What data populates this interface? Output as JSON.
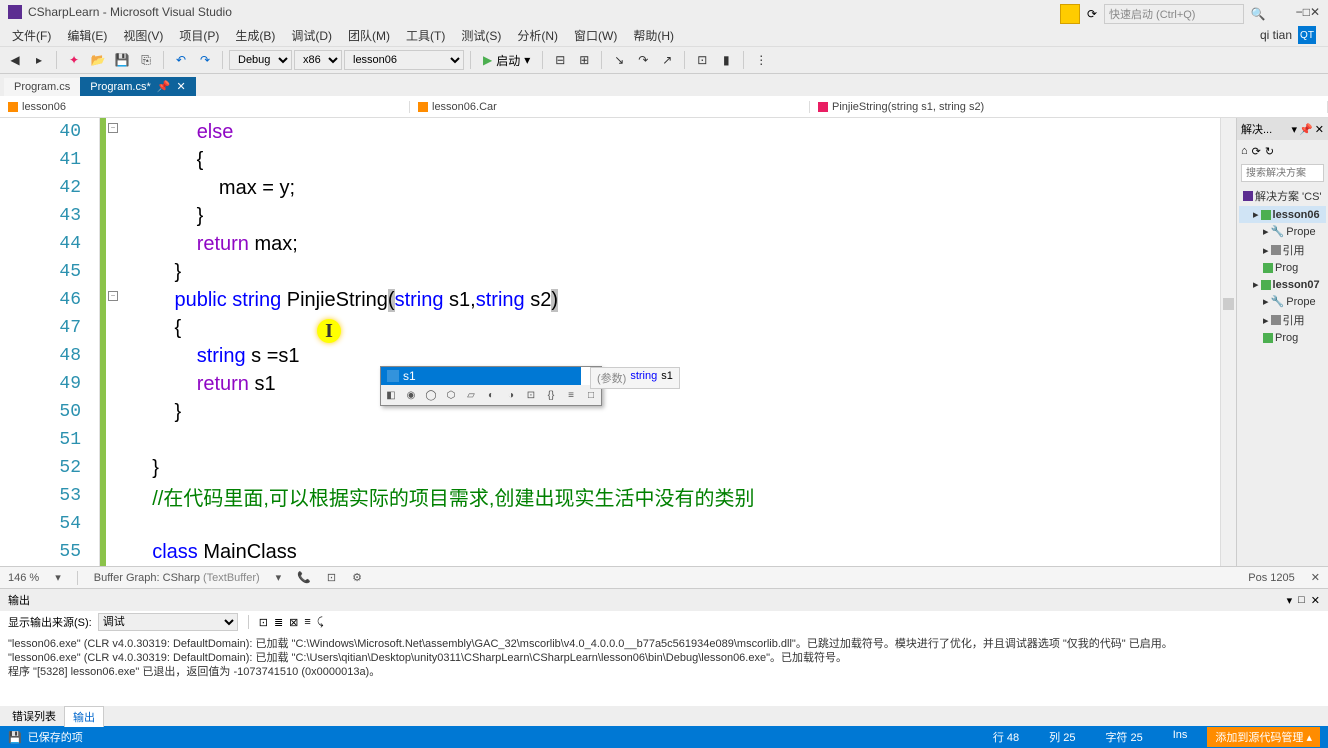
{
  "window": {
    "title": "CSharpLearn - Microsoft Visual Studio"
  },
  "quicklaunch": {
    "placeholder": "快速启动 (Ctrl+Q)"
  },
  "menu": {
    "items": [
      "文件(F)",
      "编辑(E)",
      "视图(V)",
      "项目(P)",
      "生成(B)",
      "调试(D)",
      "团队(M)",
      "工具(T)",
      "测试(S)",
      "分析(N)",
      "窗口(W)",
      "帮助(H)"
    ],
    "user": "qi tian",
    "user_badge": "QT"
  },
  "toolbar": {
    "config": "Debug",
    "platform": "x86",
    "project": "lesson06",
    "start": "启动"
  },
  "tabs": {
    "inactive": "Program.cs",
    "active": "Program.cs*"
  },
  "breadcrumb": {
    "project": "lesson06",
    "class": "lesson06.Car",
    "method": "PinjieString(string s1, string s2)"
  },
  "code": {
    "lines": [
      {
        "num": "40",
        "tokens": [
          {
            "t": "            ",
            "c": ""
          },
          {
            "t": "else",
            "c": "kw-purple"
          }
        ]
      },
      {
        "num": "41",
        "tokens": [
          {
            "t": "            {",
            "c": "punct"
          }
        ]
      },
      {
        "num": "42",
        "tokens": [
          {
            "t": "                max = y;",
            "c": "ident"
          }
        ]
      },
      {
        "num": "43",
        "tokens": [
          {
            "t": "            }",
            "c": "punct"
          }
        ]
      },
      {
        "num": "44",
        "tokens": [
          {
            "t": "            ",
            "c": ""
          },
          {
            "t": "return",
            "c": "kw-purple"
          },
          {
            "t": " max;",
            "c": "ident"
          }
        ]
      },
      {
        "num": "45",
        "tokens": [
          {
            "t": "        }",
            "c": "punct"
          }
        ]
      },
      {
        "num": "46",
        "tokens": [
          {
            "t": "        ",
            "c": ""
          },
          {
            "t": "public",
            "c": "kw-blue"
          },
          {
            "t": " ",
            "c": ""
          },
          {
            "t": "string",
            "c": "kw-blue"
          },
          {
            "t": " PinjieString",
            "c": "ident"
          },
          {
            "t": "(",
            "c": "paren-highlight"
          },
          {
            "t": "string",
            "c": "kw-blue"
          },
          {
            "t": " s1,",
            "c": "ident"
          },
          {
            "t": "string",
            "c": "kw-blue"
          },
          {
            "t": " s2",
            "c": "ident"
          },
          {
            "t": ")",
            "c": "paren-highlight"
          }
        ]
      },
      {
        "num": "47",
        "tokens": [
          {
            "t": "        {",
            "c": "punct"
          }
        ]
      },
      {
        "num": "48",
        "tokens": [
          {
            "t": "            ",
            "c": ""
          },
          {
            "t": "string",
            "c": "kw-blue"
          },
          {
            "t": " s =s1",
            "c": "ident"
          }
        ]
      },
      {
        "num": "49",
        "tokens": [
          {
            "t": "            ",
            "c": ""
          },
          {
            "t": "return",
            "c": "kw-purple"
          },
          {
            "t": " s1",
            "c": "ident"
          }
        ]
      },
      {
        "num": "50",
        "tokens": [
          {
            "t": "        }",
            "c": "punct"
          }
        ]
      },
      {
        "num": "51",
        "tokens": [
          {
            "t": "",
            "c": ""
          }
        ]
      },
      {
        "num": "52",
        "tokens": [
          {
            "t": "    }",
            "c": "punct"
          }
        ]
      },
      {
        "num": "53",
        "tokens": [
          {
            "t": "    ",
            "c": ""
          },
          {
            "t": "//在代码里面,可以根据实际的项目需求,创建出现实生活中没有的类别",
            "c": "comment"
          }
        ]
      },
      {
        "num": "54",
        "tokens": [
          {
            "t": "",
            "c": ""
          }
        ]
      },
      {
        "num": "55",
        "tokens": [
          {
            "t": "    ",
            "c": ""
          },
          {
            "t": "class",
            "c": "kw-blue"
          },
          {
            "t": " MainClass",
            "c": "ident"
          }
        ]
      }
    ]
  },
  "intellisense": {
    "selected": "s1",
    "tooltip_label": "(参数)",
    "tooltip_type": "string",
    "tooltip_name": "s1"
  },
  "info_bar": {
    "zoom": "146 %",
    "buffer": "Buffer Graph:",
    "lang": "CSharp",
    "textbuf": "(TextBuffer)",
    "pos": "Pos 1205"
  },
  "output": {
    "title": "输出",
    "source_label": "显示输出来源(S):",
    "source": "调试",
    "lines": [
      "\"lesson06.exe\" (CLR v4.0.30319: DefaultDomain): 已加载 \"C:\\Windows\\Microsoft.Net\\assembly\\GAC_32\\mscorlib\\v4.0_4.0.0.0__b77a5c561934e089\\mscorlib.dll\"。已跳过加载符号。模块进行了优化，并且调试器选项 \"仅我的代码\" 已启用。",
      "\"lesson06.exe\" (CLR v4.0.30319: DefaultDomain): 已加载 \"C:\\Users\\qitian\\Desktop\\unity0311\\CSharpLearn\\CSharpLearn\\lesson06\\bin\\Debug\\lesson06.exe\"。已加载符号。",
      "程序 \"[5328] lesson06.exe\" 已退出，返回值为 -1073741510 (0x0000013a)。"
    ]
  },
  "error_tabs": {
    "list": "错误列表",
    "output": "输出"
  },
  "status": {
    "msg": "已保存的项",
    "line": "行 48",
    "col": "列 25",
    "char": "字符 25",
    "ins": "Ins",
    "git": "添加到源代码管理"
  },
  "solution": {
    "header": "解决...",
    "search_placeholder": "搜索解决方案",
    "root": "解决方案 'CS'",
    "items": [
      "lesson06",
      "Prope",
      "引用",
      "Prog",
      "lesson07",
      "Prope",
      "引用",
      "Prog"
    ]
  }
}
